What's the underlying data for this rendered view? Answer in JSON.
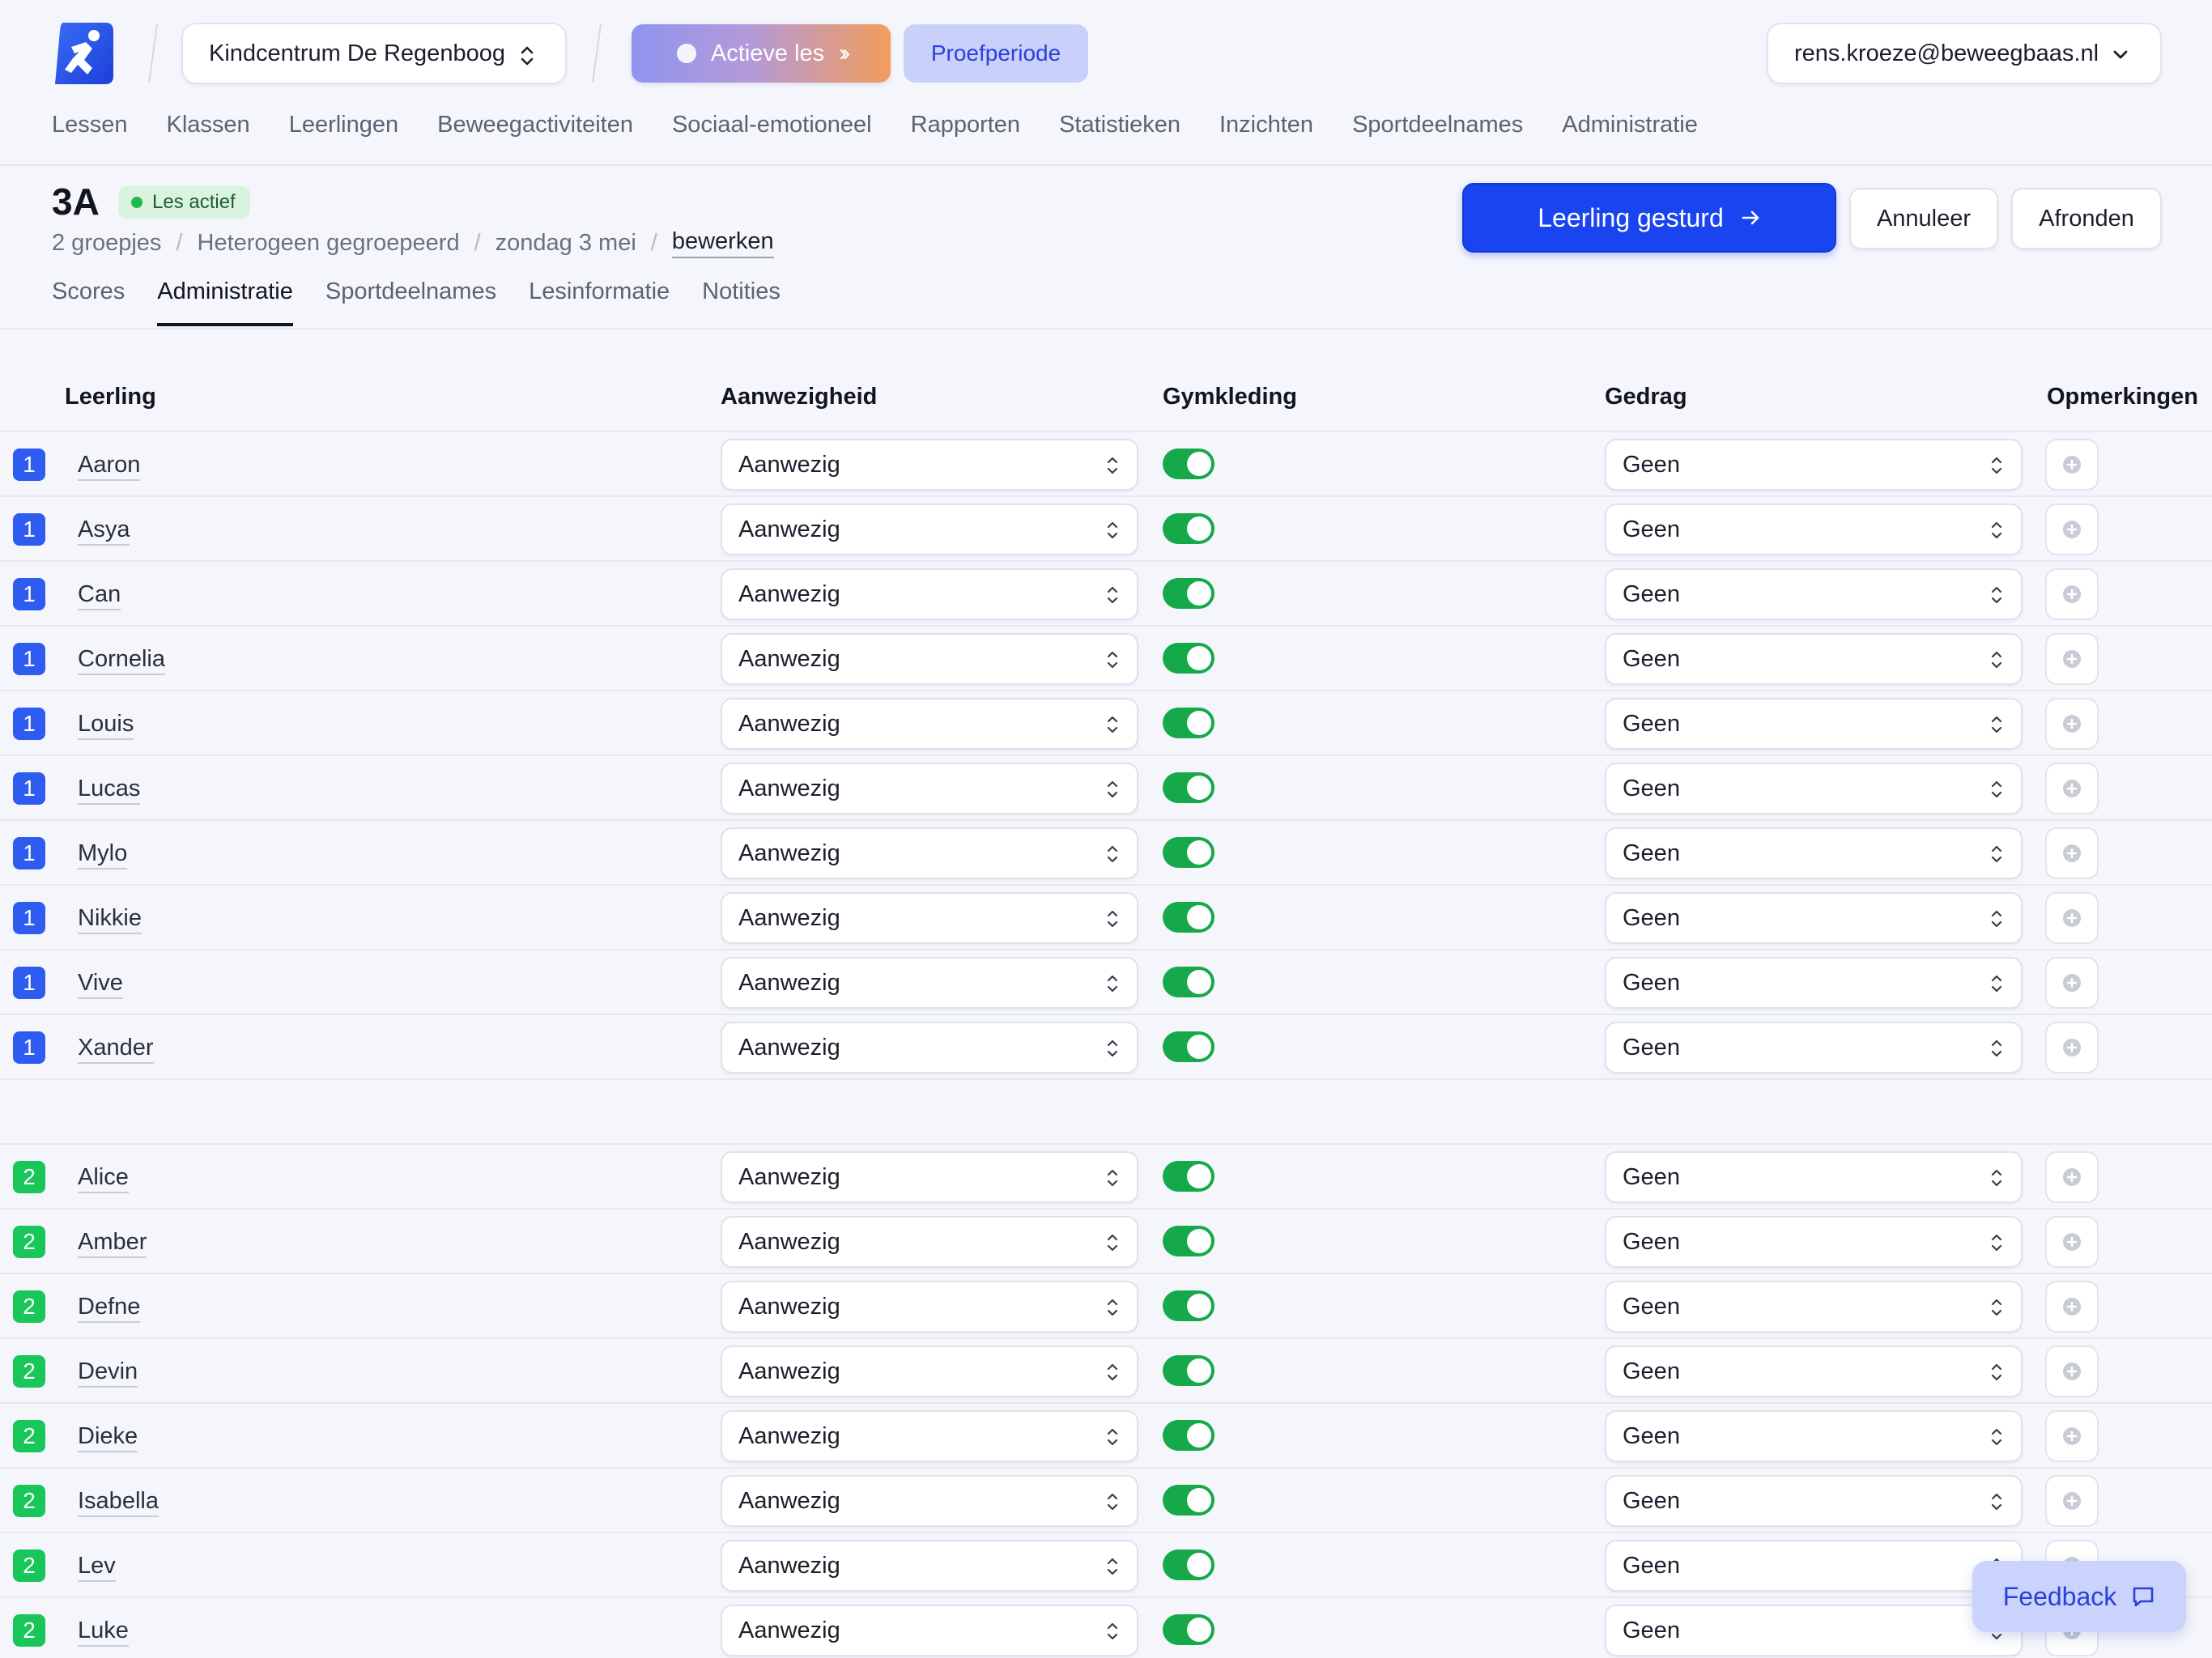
{
  "header": {
    "school": "Kindcentrum De Regenboog",
    "active_lesson_label": "Actieve les",
    "trial_label": "Proefperiode",
    "user_email": "rens.kroeze@beweegbaas.nl",
    "nav": [
      "Lessen",
      "Klassen",
      "Leerlingen",
      "Beweegactiviteiten",
      "Sociaal-emotioneel",
      "Rapporten",
      "Statistieken",
      "Inzichten",
      "Sportdeelnames",
      "Administratie"
    ]
  },
  "lesson": {
    "class_name": "3A",
    "status": "Les actief",
    "breadcrumb": [
      "2 groepjes",
      "Heterogeen gegroepeerd",
      "zondag 3 mei"
    ],
    "edit_label": "bewerken",
    "primary_action": "Leerling gesturd",
    "cancel_label": "Annuleer",
    "finish_label": "Afronden",
    "tabs": [
      "Scores",
      "Administratie",
      "Sportdeelnames",
      "Lesinformatie",
      "Notities"
    ],
    "active_tab": "Administratie"
  },
  "table": {
    "columns": {
      "student": "Leerling",
      "attendance": "Aanwezigheid",
      "gym_clothes": "Gymkleding",
      "behaviour": "Gedrag",
      "remarks": "Opmerkingen"
    },
    "groups": [
      {
        "number": "1",
        "color": "#2e5bf0",
        "students": [
          {
            "name": "Aaron",
            "attendance": "Aanwezig",
            "gym_clothes": true,
            "behaviour": "Geen"
          },
          {
            "name": "Asya",
            "attendance": "Aanwezig",
            "gym_clothes": true,
            "behaviour": "Geen"
          },
          {
            "name": "Can",
            "attendance": "Aanwezig",
            "gym_clothes": true,
            "behaviour": "Geen"
          },
          {
            "name": "Cornelia",
            "attendance": "Aanwezig",
            "gym_clothes": true,
            "behaviour": "Geen"
          },
          {
            "name": "Louis",
            "attendance": "Aanwezig",
            "gym_clothes": true,
            "behaviour": "Geen"
          },
          {
            "name": "Lucas",
            "attendance": "Aanwezig",
            "gym_clothes": true,
            "behaviour": "Geen"
          },
          {
            "name": "Mylo",
            "attendance": "Aanwezig",
            "gym_clothes": true,
            "behaviour": "Geen"
          },
          {
            "name": "Nikkie",
            "attendance": "Aanwezig",
            "gym_clothes": true,
            "behaviour": "Geen"
          },
          {
            "name": "Vive",
            "attendance": "Aanwezig",
            "gym_clothes": true,
            "behaviour": "Geen"
          },
          {
            "name": "Xander",
            "attendance": "Aanwezig",
            "gym_clothes": true,
            "behaviour": "Geen"
          }
        ]
      },
      {
        "number": "2",
        "color": "#18c65a",
        "students": [
          {
            "name": "Alice",
            "attendance": "Aanwezig",
            "gym_clothes": true,
            "behaviour": "Geen"
          },
          {
            "name": "Amber",
            "attendance": "Aanwezig",
            "gym_clothes": true,
            "behaviour": "Geen"
          },
          {
            "name": "Defne",
            "attendance": "Aanwezig",
            "gym_clothes": true,
            "behaviour": "Geen"
          },
          {
            "name": "Devin",
            "attendance": "Aanwezig",
            "gym_clothes": true,
            "behaviour": "Geen"
          },
          {
            "name": "Dieke",
            "attendance": "Aanwezig",
            "gym_clothes": true,
            "behaviour": "Geen"
          },
          {
            "name": "Isabella",
            "attendance": "Aanwezig",
            "gym_clothes": true,
            "behaviour": "Geen"
          },
          {
            "name": "Lev",
            "attendance": "Aanwezig",
            "gym_clothes": true,
            "behaviour": "Geen"
          },
          {
            "name": "Luke",
            "attendance": "Aanwezig",
            "gym_clothes": true,
            "behaviour": "Geen"
          }
        ]
      }
    ]
  },
  "feedback_label": "Feedback",
  "colors": {
    "accent": "#1a44f0",
    "toggle_on": "#16a94a",
    "status_bg": "#d9f3df"
  }
}
